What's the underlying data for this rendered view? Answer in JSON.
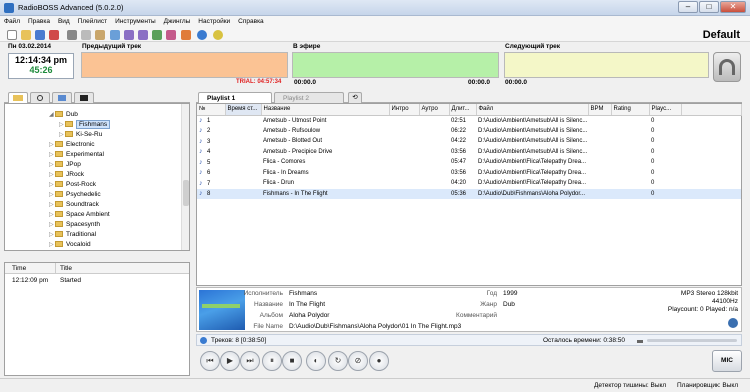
{
  "window": {
    "title": "RadioBOSS Advanced (5.0.2.0)",
    "profile": "Default"
  },
  "menu": [
    "Файл",
    "Правка",
    "Вид",
    "Плейлист",
    "Инструменты",
    "Джинглы",
    "Настройки",
    "Справка"
  ],
  "clock": {
    "date": "Пн 03.02.2014",
    "time": "12:14:34 pm",
    "countdown": "45:26"
  },
  "decks": {
    "previous": {
      "label": "Предыдущий трек",
      "trial": "TRIAL: 04:57:34"
    },
    "onair": {
      "label": "В эфире",
      "time": "00:00.0",
      "time_right": "00:00.0"
    },
    "next": {
      "label": "Следующий трек",
      "time": "00:00.0"
    }
  },
  "tree": [
    {
      "label": "Dub",
      "level": 0,
      "expanded": true
    },
    {
      "label": "Fishmans",
      "level": 1,
      "selected": true
    },
    {
      "label": "Ki-Se-Ru",
      "level": 1
    },
    {
      "label": "Electronic",
      "level": 0
    },
    {
      "label": "Experimental",
      "level": 0
    },
    {
      "label": "JPop",
      "level": 0
    },
    {
      "label": "JRock",
      "level": 0
    },
    {
      "label": "Post-Rock",
      "level": 0
    },
    {
      "label": "Psychedelic",
      "level": 0
    },
    {
      "label": "Soundtrack",
      "level": 0
    },
    {
      "label": "Space Ambient",
      "level": 0
    },
    {
      "label": "Spacesynth",
      "level": 0
    },
    {
      "label": "Traditional",
      "level": 0
    },
    {
      "label": "Vocaloid",
      "level": 0
    }
  ],
  "log": {
    "headers": [
      "Time",
      "Title"
    ],
    "rows": [
      {
        "time": "12:12:09 pm",
        "title": "Started"
      }
    ]
  },
  "playlist": {
    "tabs": [
      "Playlist 1",
      "Playlist 2"
    ],
    "headers": [
      "№",
      "Время ст...",
      "Название",
      "Интро",
      "Аутро",
      "Длит...",
      "Файл",
      "BPM",
      "Rating",
      "Playc..."
    ],
    "rows": [
      {
        "n": "1",
        "title": "Ametsub - Utmost Point",
        "dur": "02:51",
        "file": "D:\\Audio\\Ambient\\Ametsub\\All is Silenc...",
        "plays": "0"
      },
      {
        "n": "2",
        "title": "Ametsub - Rufsoulow",
        "dur": "06:22",
        "file": "D:\\Audio\\Ambient\\Ametsub\\All is Silenc...",
        "plays": "0"
      },
      {
        "n": "3",
        "title": "Ametsub - Blotted Out",
        "dur": "04:22",
        "file": "D:\\Audio\\Ambient\\Ametsub\\All is Silenc...",
        "plays": "0"
      },
      {
        "n": "4",
        "title": "Ametsub - Precipice Drive",
        "dur": "03:56",
        "file": "D:\\Audio\\Ambient\\Ametsub\\All is Silenc...",
        "plays": "0"
      },
      {
        "n": "5",
        "title": "Flica - Comores",
        "dur": "05:47",
        "file": "D:\\Audio\\Ambient\\Flica\\Telepathy Drea...",
        "plays": "0"
      },
      {
        "n": "6",
        "title": "Flica - In Dreams",
        "dur": "03:56",
        "file": "D:\\Audio\\Ambient\\Flica\\Telepathy Drea...",
        "plays": "0"
      },
      {
        "n": "7",
        "title": "Flica - Drun",
        "dur": "04:20",
        "file": "D:\\Audio\\Ambient\\Flica\\Telepathy Drea...",
        "plays": "0"
      },
      {
        "n": "8",
        "title": "Fishmans - In The Flight",
        "dur": "05:36",
        "file": "D:\\Audio\\Dub\\Fishmans\\Aloha Polydor...",
        "plays": "0",
        "selected": true
      }
    ]
  },
  "trackinfo": {
    "artist_label": "Исполнитель",
    "artist": "Fishmans",
    "title_label": "Название",
    "title": "In The Flight",
    "album_label": "Альбом",
    "album": "Aloha Polydor",
    "file_label": "File Name",
    "file": "D:\\Audio\\Dub\\Fishmans\\Aloha Polydor\\01 In The Flight.mp3",
    "year_label": "Год",
    "year": "1999",
    "genre_label": "Жанр",
    "genre": "Dub",
    "comment_label": "Комментарий",
    "format": "MP3 Stereo 128kbit",
    "rate": "44100Hz",
    "playcount": "Playcount: 0  Played: n/a"
  },
  "summary": {
    "tracks": "Треков: 8 [0:38:50]",
    "remaining": "Осталось времени: 0:38:50"
  },
  "status": {
    "silence": "Детектор тишины: Выкл",
    "scheduler": "Планировщик: Выкл"
  },
  "mic_label": "MIC",
  "colors": {
    "previous": "#fbc394",
    "onair": "#b6f0a8",
    "next": "#f4f7c8",
    "selection": "#dbe9fb"
  }
}
